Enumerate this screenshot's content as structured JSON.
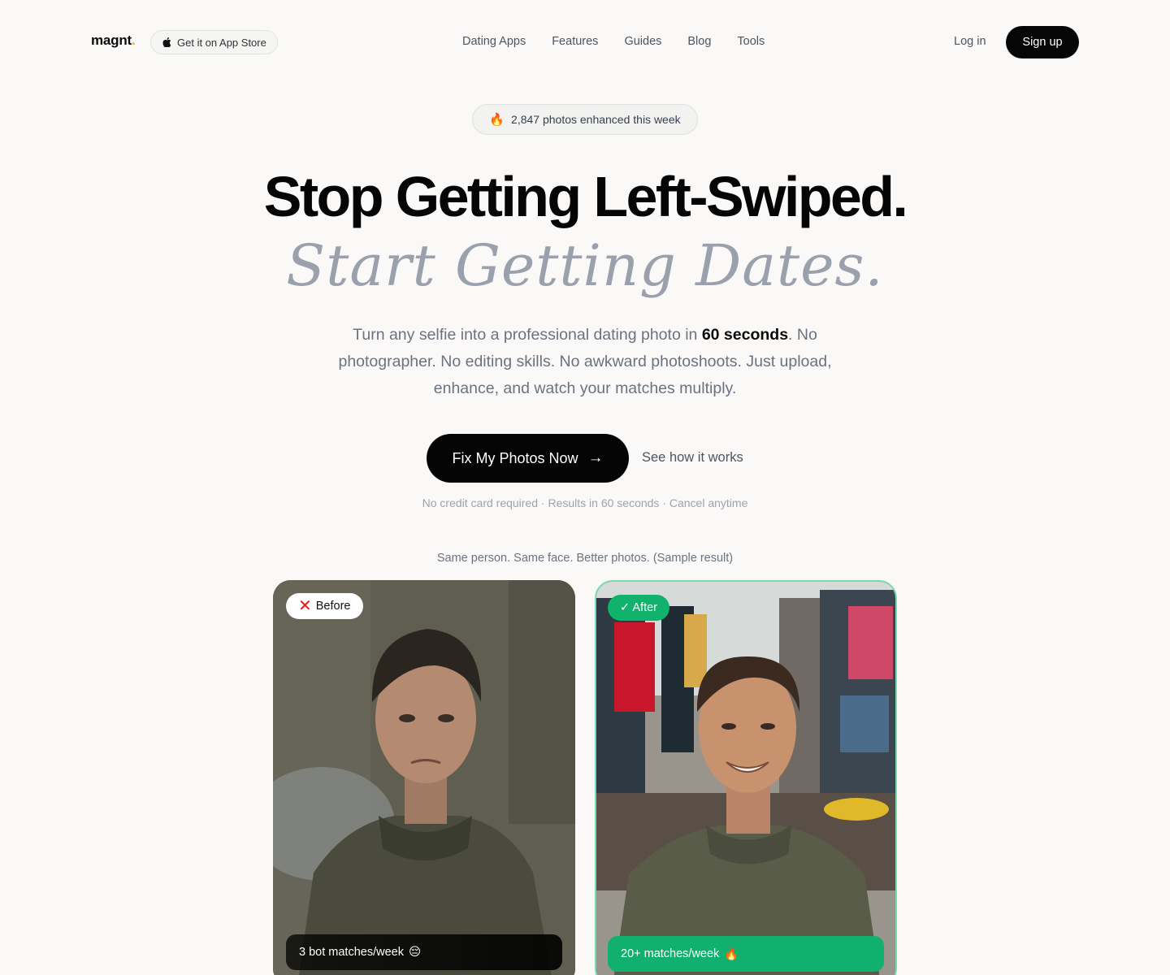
{
  "header": {
    "logo_text": "magnt",
    "logo_dot": ".",
    "appstore_label": "Get it on App Store",
    "nav": [
      "Dating Apps",
      "Features",
      "Guides",
      "Blog",
      "Tools"
    ],
    "login_label": "Log in",
    "signup_label": "Sign up"
  },
  "hero": {
    "pill_icon": "fire-icon",
    "pill_text": "2,847 photos enhanced this week",
    "headline": "Stop Getting Left-Swiped.",
    "headline_italic": "Start Getting Dates.",
    "sub_part1": "Turn any selfie into a professional dating photo in ",
    "sub_bold": "60 seconds",
    "sub_part2": ". No photographer. No editing skills. No awkward photoshoots. Just upload, enhance, and watch your matches multiply.",
    "cta_label": "Fix My Photos Now",
    "secondary_label": "See how it works",
    "fine_print": "No credit card required · Results in 60 seconds · Cancel anytime"
  },
  "comparison": {
    "caption": "Same person. Same face. Better photos. (Sample result)",
    "before": {
      "badge_icon": "x-mark-icon",
      "badge_label": "Before",
      "stat_label": "3 bot matches/week",
      "stat_emoji": "😔"
    },
    "after": {
      "badge_label": "✓ After",
      "stat_label": "20+ matches/week",
      "stat_emoji": "🔥"
    }
  },
  "colors": {
    "accent_green": "#10b26c",
    "brand_dot": "#f5a524",
    "italic_gray": "#9aa1ad"
  }
}
